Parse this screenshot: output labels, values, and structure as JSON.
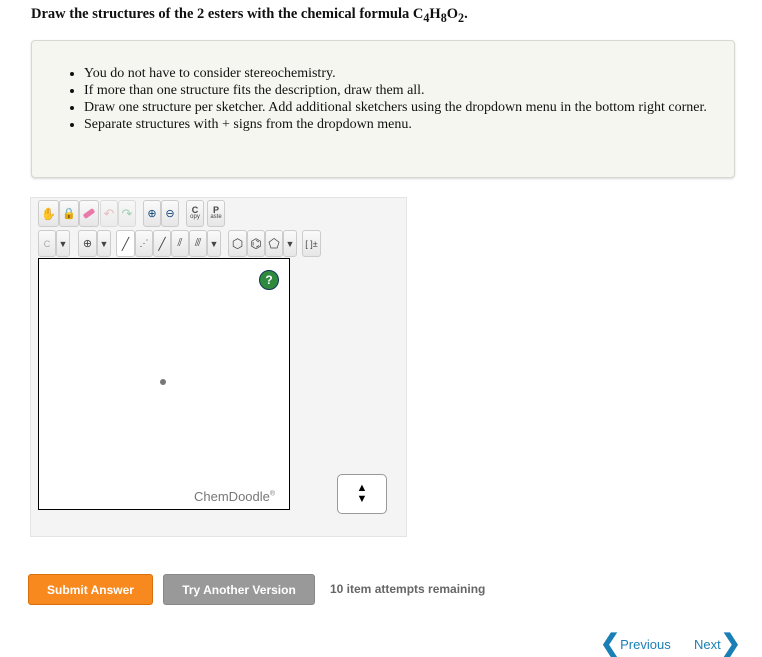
{
  "question": {
    "prefix": "Draw the structures of the 2 esters with the chemical formula C",
    "c": "4",
    "h": "H",
    "hn": "8",
    "o": "O",
    "on": "2",
    "end": "."
  },
  "instructions": [
    "You do not have to consider stereochemistry.",
    "If more than one structure fits the description, draw them all.",
    "Draw one structure per sketcher. Add additional sketchers using the dropdown menu in the bottom right corner.",
    "Separate structures with + signs from the dropdown menu."
  ],
  "toolbar": {
    "copy": "C",
    "copy_sub": "opy",
    "paste": "P",
    "paste_sub": "aste",
    "element": "C",
    "charge": "[ ]±"
  },
  "sketcher": {
    "help": "?",
    "brand": "ChemDoodle",
    "reg": "®"
  },
  "buttons": {
    "submit": "Submit Answer",
    "try_another": "Try Another Version"
  },
  "attempts": "10 item attempts remaining",
  "nav": {
    "previous": "Previous",
    "next": "Next"
  },
  "colors": {
    "submit": "#f7891f",
    "link": "#1a7fb5"
  }
}
